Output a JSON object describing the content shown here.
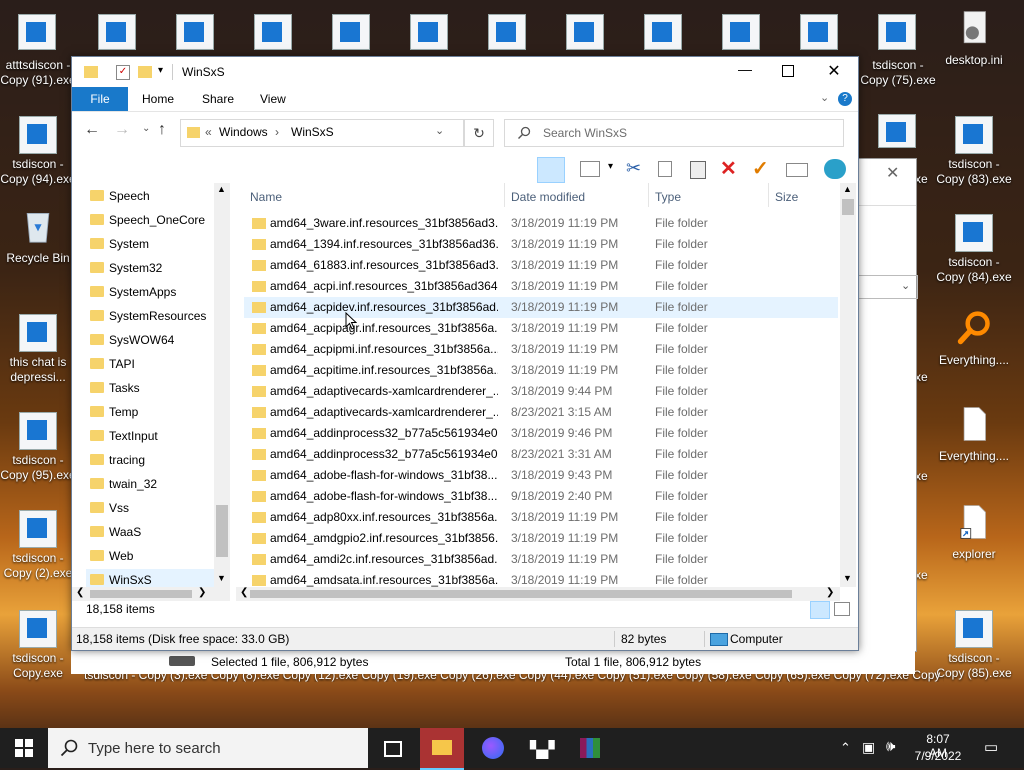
{
  "desktop": {
    "top_row_labels": [
      "atttsdiscon - Copy (91).exe"
    ],
    "icons_left": [
      {
        "label": "tsdiscon - Copy (94).exe"
      },
      {
        "label": "Recycle Bin"
      },
      {
        "label": "this chat is depressi..."
      },
      {
        "label": "tsdiscon - Copy (95).exe"
      },
      {
        "label": "tsdiscon - Copy (2).exe"
      },
      {
        "label": "tsdiscon - Copy.exe"
      }
    ],
    "icons_right": [
      {
        "label": "desktop.ini"
      },
      {
        "label": "tsdiscon - Copy (75).exe"
      },
      {
        "label": "tsdiscon - Copy (83).exe"
      },
      {
        "label": "tsdiscon - Copy (84).exe"
      },
      {
        "label": "Everything...."
      },
      {
        "label": "Everything...."
      },
      {
        "label": "explorer"
      },
      {
        "label": "tsdiscon - Copy (85).exe"
      }
    ],
    "partial_exe_labels": [
      "exe",
      "exe",
      "exe",
      "exe",
      "exe",
      "exe"
    ],
    "bottom_row_text": "tsdiscon - Copy (3).exe  Copy (8).exe  Copy (12).exe  Copy (19).exe  Copy (26).exe  Copy (44).exe  Copy (51).exe  Copy (58).exe  Copy (65).exe  Copy (72).exe  Copy (79).exe"
  },
  "window": {
    "title": "WinSxS",
    "ribbon_tabs": [
      "File",
      "Home",
      "Share",
      "View"
    ],
    "address": {
      "prefix": "«",
      "parts": [
        "Windows",
        "WinSxS"
      ],
      "separator": "›"
    },
    "search_placeholder": "Search WinSxS",
    "nav_items": [
      "Speech",
      "Speech_OneCore",
      "System",
      "System32",
      "SystemApps",
      "SystemResources",
      "SysWOW64",
      "TAPI",
      "Tasks",
      "Temp",
      "TextInput",
      "tracing",
      "twain_32",
      "Vss",
      "WaaS",
      "Web",
      "WinSxS"
    ],
    "columns": {
      "name": "Name",
      "date": "Date modified",
      "type": "Type",
      "size": "Size"
    },
    "rows": [
      {
        "name": "amd64_3ware.inf.resources_31bf3856ad3...",
        "date": "3/18/2019 11:19 PM",
        "type": "File folder"
      },
      {
        "name": "amd64_1394.inf.resources_31bf3856ad36...",
        "date": "3/18/2019 11:19 PM",
        "type": "File folder"
      },
      {
        "name": "amd64_61883.inf.resources_31bf3856ad3...",
        "date": "3/18/2019 11:19 PM",
        "type": "File folder"
      },
      {
        "name": "amd64_acpi.inf.resources_31bf3856ad364...",
        "date": "3/18/2019 11:19 PM",
        "type": "File folder"
      },
      {
        "name": "amd64_acpidev.inf.resources_31bf3856ad...",
        "date": "3/18/2019 11:19 PM",
        "type": "File folder"
      },
      {
        "name": "amd64_acpipagr.inf.resources_31bf3856a...",
        "date": "3/18/2019 11:19 PM",
        "type": "File folder"
      },
      {
        "name": "amd64_acpipmi.inf.resources_31bf3856a...",
        "date": "3/18/2019 11:19 PM",
        "type": "File folder"
      },
      {
        "name": "amd64_acpitime.inf.resources_31bf3856a...",
        "date": "3/18/2019 11:19 PM",
        "type": "File folder"
      },
      {
        "name": "amd64_adaptivecards-xamlcardrenderer_...",
        "date": "3/18/2019 9:44 PM",
        "type": "File folder"
      },
      {
        "name": "amd64_adaptivecards-xamlcardrenderer_...",
        "date": "8/23/2021 3:15 AM",
        "type": "File folder"
      },
      {
        "name": "amd64_addinprocess32_b77a5c561934e0...",
        "date": "3/18/2019 9:46 PM",
        "type": "File folder"
      },
      {
        "name": "amd64_addinprocess32_b77a5c561934e0...",
        "date": "8/23/2021 3:31 AM",
        "type": "File folder"
      },
      {
        "name": "amd64_adobe-flash-for-windows_31bf38...",
        "date": "3/18/2019 9:43 PM",
        "type": "File folder"
      },
      {
        "name": "amd64_adobe-flash-for-windows_31bf38...",
        "date": "9/18/2019 2:40 PM",
        "type": "File folder"
      },
      {
        "name": "amd64_adp80xx.inf.resources_31bf3856a...",
        "date": "3/18/2019 11:19 PM",
        "type": "File folder"
      },
      {
        "name": "amd64_amdgpio2.inf.resources_31bf3856...",
        "date": "3/18/2019 11:19 PM",
        "type": "File folder"
      },
      {
        "name": "amd64_amdi2c.inf.resources_31bf3856ad...",
        "date": "3/18/2019 11:19 PM",
        "type": "File folder"
      },
      {
        "name": "amd64_amdsata.inf.resources_31bf3856a...",
        "date": "3/18/2019 11:19 PM",
        "type": "File folder"
      }
    ],
    "status_count": "18,158 items",
    "details": {
      "items": "18,158 items (Disk free space: 33.0 GB)",
      "size": "82 bytes",
      "location": "Computer"
    },
    "extra_bar": {
      "selected": "Selected 1 file, 806,912 bytes",
      "total": "Total 1 file, 806,912 bytes"
    }
  },
  "taskbar": {
    "search_placeholder": "Type here to search",
    "time": "8:07 AM",
    "date": "7/9/2022"
  },
  "colors": {
    "accent": "#1979ca",
    "folder": "#f6d36b",
    "selection": "#e5f3ff",
    "taskbar": "#1f1f1f"
  }
}
